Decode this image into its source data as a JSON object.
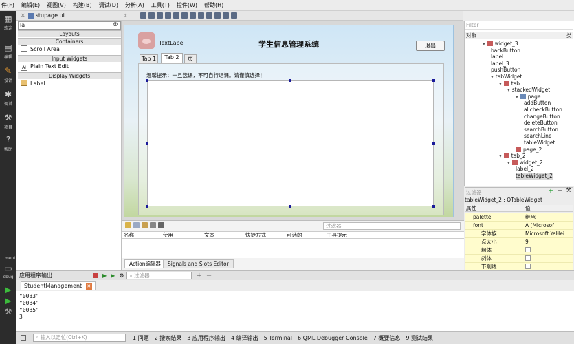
{
  "menu": [
    "件(F)",
    "编辑(E)",
    "视图(V)",
    "构建(B)",
    "调试(D)",
    "分析(A)",
    "工具(T)",
    "控件(W)",
    "帮助(H)"
  ],
  "file_tab": {
    "name": "stupage.ui"
  },
  "modes": [
    {
      "label": "欢迎",
      "icon": "grid-icon"
    },
    {
      "label": "编辑",
      "icon": "document-icon"
    },
    {
      "label": "设计",
      "icon": "pencil-icon"
    },
    {
      "label": "调试",
      "icon": "bug-icon"
    },
    {
      "label": "项目",
      "icon": "wrench-icon"
    },
    {
      "label": "帮助",
      "icon": "help-icon"
    }
  ],
  "mode_target": {
    "label": "...ment",
    "sub": "ebug"
  },
  "widget_box": {
    "filter": "la",
    "categories": [
      "Layouts",
      "Containers",
      "Input Widgets",
      "Display Widgets"
    ],
    "items": [
      "Scroll Area",
      "Plain Text Edit",
      "Label"
    ]
  },
  "form": {
    "text_label": "TextLabel",
    "title": "学生信息管理系统",
    "back_button": "退出",
    "tabs": [
      "Tab 1",
      "Tab 2",
      "页"
    ],
    "hint": "温馨提示：一旦选课，不可自行退课。请谨慎选择！"
  },
  "action_editor": {
    "filter_placeholder": "过滤器",
    "columns": [
      "名称",
      "使用",
      "文本",
      "快捷方式",
      "可选的",
      "工具提示"
    ],
    "tabs": [
      "Action编辑器",
      "Signals and Slots Editor"
    ]
  },
  "object_inspector": {
    "filter_placeholder": "Filter",
    "columns": [
      "对象",
      "类"
    ],
    "rows": [
      {
        "name": "widget_3",
        "depth": 2,
        "arrow": "▾",
        "icon": "red"
      },
      {
        "name": "backButton",
        "depth": 3,
        "arrow": "",
        "icon": ""
      },
      {
        "name": "label",
        "depth": 3,
        "arrow": "",
        "icon": ""
      },
      {
        "name": "label_3",
        "depth": 3,
        "arrow": "",
        "icon": ""
      },
      {
        "name": "pushButton",
        "depth": 3,
        "arrow": "",
        "icon": ""
      },
      {
        "name": "tabWidget",
        "depth": 3,
        "arrow": "▾",
        "icon": ""
      },
      {
        "name": "tab",
        "depth": 4,
        "arrow": "▾",
        "icon": "red"
      },
      {
        "name": "stackedWidget",
        "depth": 5,
        "arrow": "▾",
        "icon": ""
      },
      {
        "name": "page",
        "depth": 6,
        "arrow": "▾",
        "icon": "blue"
      },
      {
        "name": "addButton",
        "depth": 7,
        "arrow": "",
        "icon": ""
      },
      {
        "name": "allcheckButton",
        "depth": 7,
        "arrow": "",
        "icon": ""
      },
      {
        "name": "changeButton",
        "depth": 7,
        "arrow": "",
        "icon": ""
      },
      {
        "name": "deleteButton",
        "depth": 7,
        "arrow": "",
        "icon": ""
      },
      {
        "name": "searchButton",
        "depth": 7,
        "arrow": "",
        "icon": ""
      },
      {
        "name": "searchLine",
        "depth": 7,
        "arrow": "",
        "icon": ""
      },
      {
        "name": "tableWidget",
        "depth": 7,
        "arrow": "",
        "icon": ""
      },
      {
        "name": "page_2",
        "depth": 6,
        "arrow": "",
        "icon": "red"
      },
      {
        "name": "tab_2",
        "depth": 4,
        "arrow": "▾",
        "icon": "red"
      },
      {
        "name": "widget_2",
        "depth": 5,
        "arrow": "▾",
        "icon": "red"
      },
      {
        "name": "label_2",
        "depth": 6,
        "arrow": "",
        "icon": ""
      },
      {
        "name": "tableWidget_2",
        "depth": 6,
        "arrow": "",
        "icon": ""
      }
    ]
  },
  "property_editor": {
    "filter_placeholder": "过滤器",
    "class_label": "tableWidget_2 : QTableWidget",
    "columns": [
      "属性",
      "值"
    ],
    "rows": [
      {
        "name": "palette",
        "value": "继承",
        "kind": "text",
        "indent": 0
      },
      {
        "name": "font",
        "value": "A [Microsof",
        "kind": "text",
        "indent": 0
      },
      {
        "name": "字体族",
        "value": "Microsoft YaHei",
        "kind": "text",
        "indent": 1
      },
      {
        "name": "点大小",
        "value": "9",
        "kind": "text",
        "indent": 1
      },
      {
        "name": "粗体",
        "value": "",
        "kind": "check",
        "indent": 1
      },
      {
        "name": "斜体",
        "value": "",
        "kind": "check",
        "indent": 1
      },
      {
        "name": "下划线",
        "value": "",
        "kind": "check",
        "indent": 1
      }
    ]
  },
  "output": {
    "title": "应用程序输出",
    "filter_placeholder": "过滤器",
    "tab": "StudentManagement",
    "lines": [
      "\"0033\"",
      "\"0034\"",
      "\"0035\"",
      "3"
    ]
  },
  "status_bar": {
    "locator_placeholder": "输入以定位(Ctrl+K)",
    "panes": [
      "1 问题",
      "2 搜索结果",
      "3 应用程序输出",
      "4 编译输出",
      "5 Terminal",
      "6 QML Debugger Console",
      "7 概要信息",
      "9 测试结果"
    ]
  }
}
